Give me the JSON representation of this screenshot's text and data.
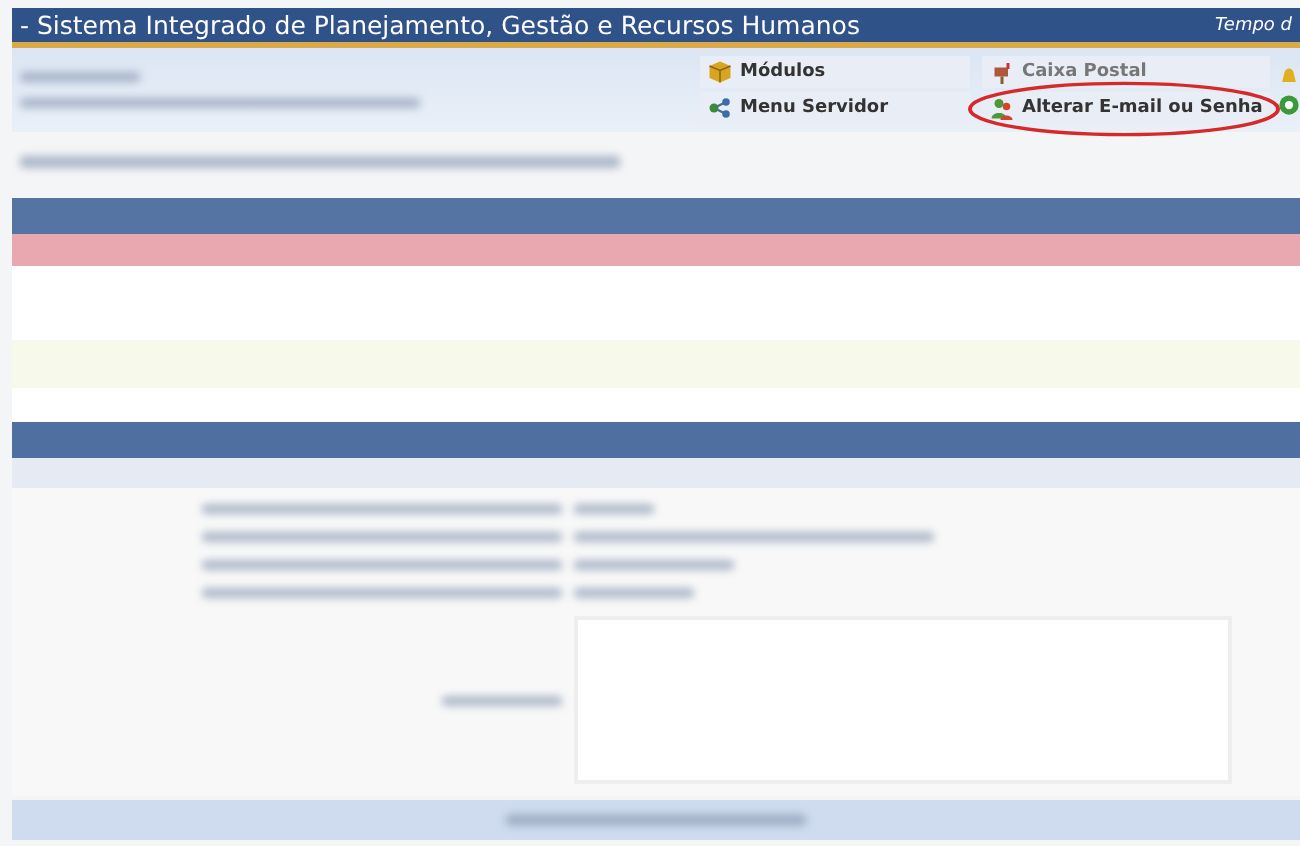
{
  "window": {
    "title": "- Sistema Integrado de Planejamento, Gestão e Recursos Humanos",
    "session_label": "Tempo d"
  },
  "menu": [
    {
      "label": "Módulos",
      "kind": "cube",
      "highlighted": false,
      "disabled": false
    },
    {
      "label": "Caixa Postal",
      "kind": "mailbox",
      "highlighted": false,
      "disabled": true
    },
    {
      "label": "Menu Servidor",
      "kind": "network",
      "highlighted": false,
      "disabled": false
    },
    {
      "label": "Alterar E-mail ou Senha",
      "kind": "people",
      "highlighted": true,
      "disabled": false
    }
  ]
}
